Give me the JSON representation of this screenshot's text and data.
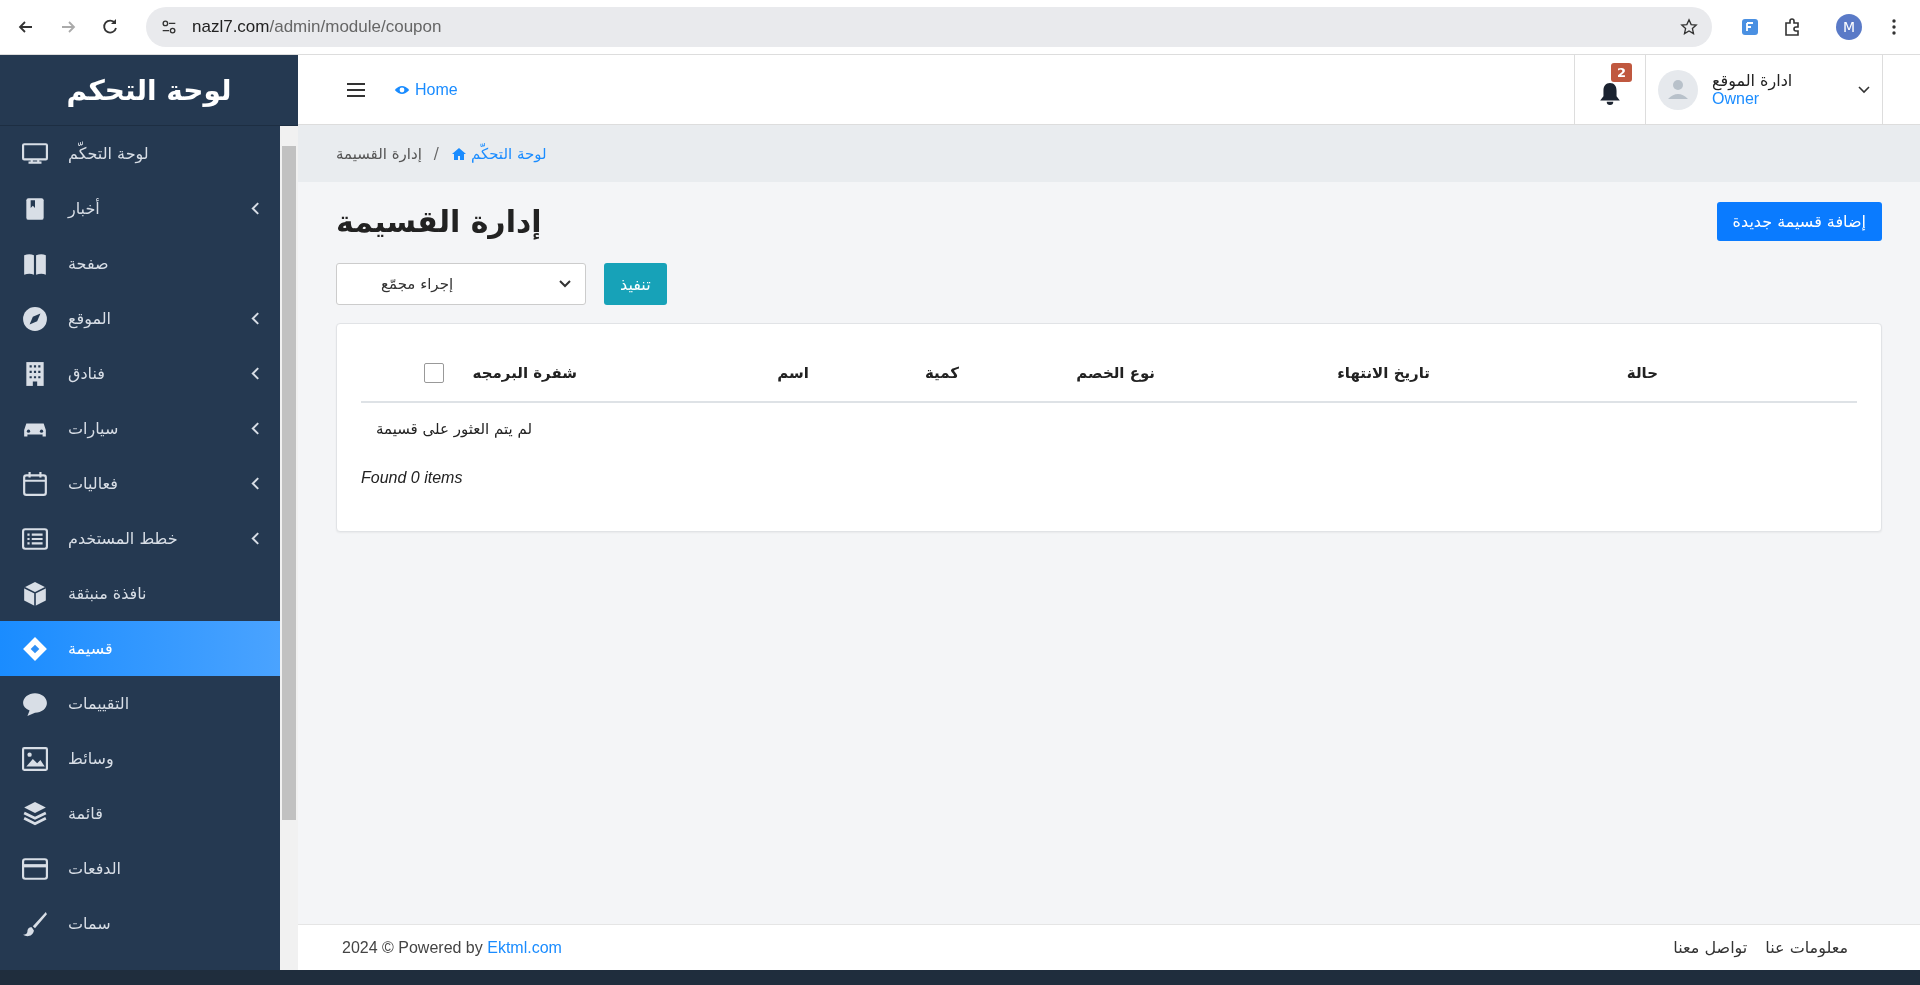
{
  "browser": {
    "url_host": "nazl7.com",
    "url_path": "/admin/module/coupon",
    "profile": "M"
  },
  "sidebar": {
    "title": "لوحة التحكم",
    "items": [
      {
        "label": "لوحة التحكّم",
        "kind": "monitor",
        "expandable": false,
        "selected": false
      },
      {
        "label": "أخبار",
        "kind": "book",
        "expandable": true,
        "selected": false
      },
      {
        "label": "صفحة",
        "kind": "pages",
        "expandable": false,
        "selected": false
      },
      {
        "label": "الموقع",
        "kind": "compass",
        "expandable": true,
        "selected": false
      },
      {
        "label": "فنادق",
        "kind": "building",
        "expandable": true,
        "selected": false
      },
      {
        "label": "سيارات",
        "kind": "car",
        "expandable": true,
        "selected": false
      },
      {
        "label": "فعاليات",
        "kind": "calendar",
        "expandable": true,
        "selected": false
      },
      {
        "label": "خطط المستخدم",
        "kind": "list",
        "expandable": true,
        "selected": false
      },
      {
        "label": "نافذة منبثقة",
        "kind": "cube",
        "expandable": false,
        "selected": false
      },
      {
        "label": "قسيمة",
        "kind": "ticket",
        "expandable": false,
        "selected": true
      },
      {
        "label": "التقييمات",
        "kind": "chat",
        "expandable": false,
        "selected": false
      },
      {
        "label": "وسائط",
        "kind": "image",
        "expandable": false,
        "selected": false
      },
      {
        "label": "قائمة",
        "kind": "layers",
        "expandable": false,
        "selected": false
      },
      {
        "label": "الدفعات",
        "kind": "card",
        "expandable": false,
        "selected": false
      },
      {
        "label": "سمات",
        "kind": "brush",
        "expandable": false,
        "selected": false
      }
    ]
  },
  "topbar": {
    "home": "Home",
    "notifications": "2",
    "user_name": "ادارة الموقع",
    "user_role": "Owner"
  },
  "breadcrumb": {
    "separator": "/",
    "items": [
      {
        "label": "لوحة التحكّم",
        "link": true
      },
      {
        "label": "إدارة القسيمة",
        "link": false
      }
    ]
  },
  "page": {
    "title": "إدارة القسيمة",
    "add_button": "إضافة قسيمة جديدة",
    "bulk_select": "إجراء مجمّع",
    "apply_button": "تنفيذ"
  },
  "table": {
    "select_all": false,
    "columns": [
      "حالة",
      "تاريخ الانتهاء",
      "نوع الخصم",
      "كمية",
      "اسم",
      "شفرة البرمجه"
    ],
    "empty": "لم يتم العثور على قسيمة",
    "found": "Found 0 items"
  },
  "footer": {
    "copyright": "2024 © Powered by ",
    "brand": "Ektml.com",
    "links": [
      "معلومات عنا",
      "تواصل معنا"
    ]
  }
}
